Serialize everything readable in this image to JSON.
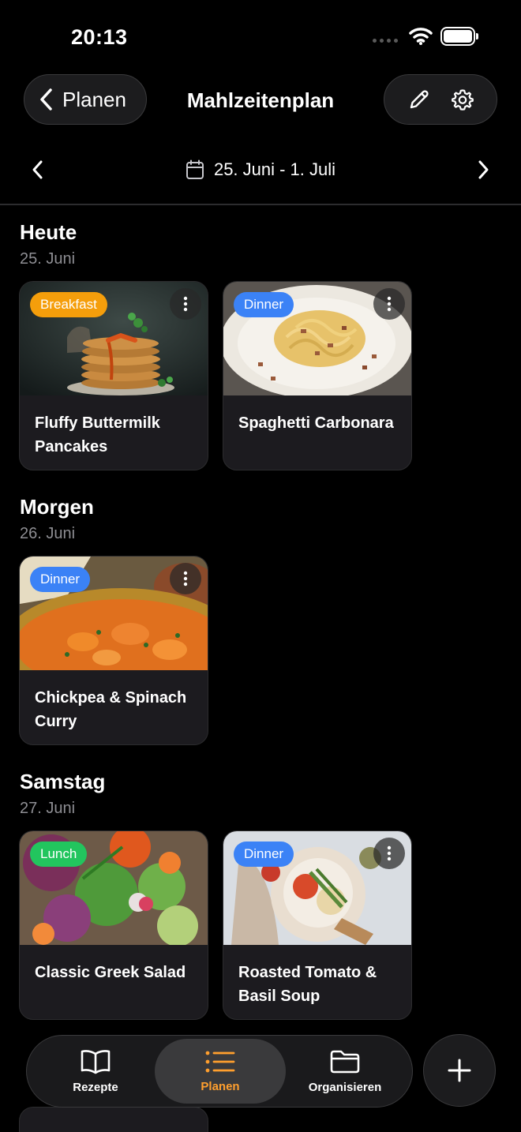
{
  "status_bar": {
    "time": "20:13"
  },
  "nav": {
    "back_label": "Planen",
    "title": "Mahlzeitenplan"
  },
  "week": {
    "range": "25. Juni - 1. Juli"
  },
  "days": [
    {
      "title": "Heute",
      "date": "25. Juni",
      "meals": [
        {
          "badge": "Breakfast",
          "badge_color": "#f59e0b",
          "title": "Fluffy Buttermilk Pancakes"
        },
        {
          "badge": "Dinner",
          "badge_color": "#3b82f6",
          "title": "Spaghetti Carbonara"
        }
      ]
    },
    {
      "title": "Morgen",
      "date": "26. Juni",
      "meals": [
        {
          "badge": "Dinner",
          "badge_color": "#3b82f6",
          "title": "Chickpea & Spinach Curry"
        }
      ]
    },
    {
      "title": "Samstag",
      "date": "27. Juni",
      "meals": [
        {
          "badge": "Lunch",
          "badge_color": "#22c55e",
          "title": "Classic Greek Salad"
        },
        {
          "badge": "Dinner",
          "badge_color": "#3b82f6",
          "title": "Roasted Tomato & Basil Soup"
        }
      ]
    }
  ],
  "tabs": [
    {
      "label": "Rezepte",
      "icon": "book-icon"
    },
    {
      "label": "Planen",
      "icon": "list-icon",
      "active": true
    },
    {
      "label": "Organisieren",
      "icon": "folder-icon"
    }
  ],
  "colors": {
    "accent": "#ff9f2e",
    "background": "#000000",
    "card": "#1c1b1f"
  }
}
